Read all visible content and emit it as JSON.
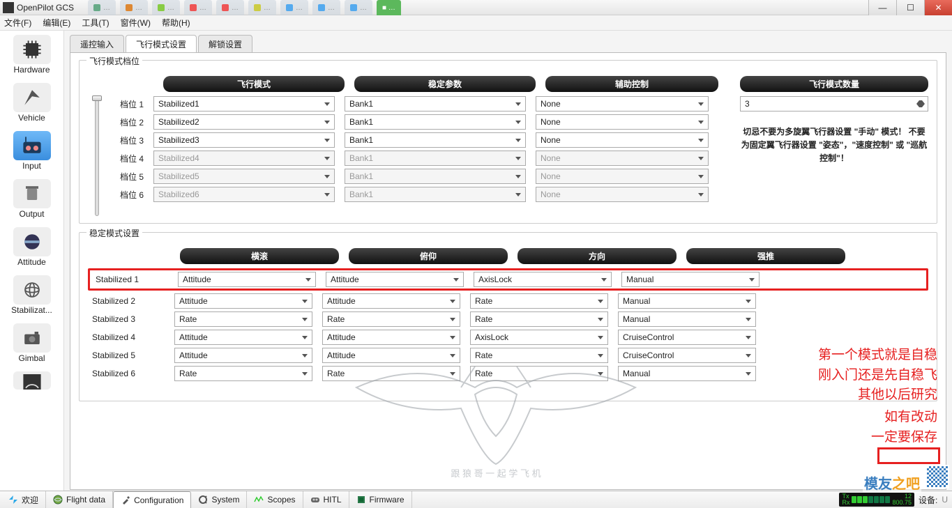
{
  "app": {
    "title": "OpenPilot GCS"
  },
  "window_buttons": {
    "min": "—",
    "max": "☐",
    "close": "✕"
  },
  "menus": [
    "文件(F)",
    "编辑(E)",
    "工具(T)",
    "窗件(W)",
    "帮助(H)"
  ],
  "sidebar": [
    {
      "key": "hardware",
      "label": "Hardware"
    },
    {
      "key": "vehicle",
      "label": "Vehicle"
    },
    {
      "key": "input",
      "label": "Input",
      "selected": true
    },
    {
      "key": "output",
      "label": "Output"
    },
    {
      "key": "attitude",
      "label": "Attitude"
    },
    {
      "key": "stabilization",
      "label": "Stabilizat..."
    },
    {
      "key": "gimbal",
      "label": "Gimbal"
    }
  ],
  "subtabs": [
    "遥控输入",
    "飞行模式设置",
    "解锁设置"
  ],
  "active_subtab": 1,
  "group1_title": "飞行模式档位",
  "headers": [
    "飞行模式",
    "稳定参数",
    "辅助控制",
    "飞行模式数量"
  ],
  "positions": [
    {
      "label": "档位 1",
      "mode": "Stabilized1",
      "bank": "Bank1",
      "aux": "None",
      "enabled": true
    },
    {
      "label": "档位 2",
      "mode": "Stabilized2",
      "bank": "Bank1",
      "aux": "None",
      "enabled": true
    },
    {
      "label": "档位 3",
      "mode": "Stabilized3",
      "bank": "Bank1",
      "aux": "None",
      "enabled": true
    },
    {
      "label": "档位 4",
      "mode": "Stabilized4",
      "bank": "Bank1",
      "aux": "None",
      "enabled": false
    },
    {
      "label": "档位 5",
      "mode": "Stabilized5",
      "bank": "Bank1",
      "aux": "None",
      "enabled": false
    },
    {
      "label": "档位 6",
      "mode": "Stabilized6",
      "bank": "Bank1",
      "aux": "None",
      "enabled": false
    }
  ],
  "mode_count": "3",
  "warning": "切忌不要为多旋翼飞行器设置 \"手动\" 模式！ 不要为固定翼飞行器设置 \"姿态\"，\"速度控制\" 或 \"巡航控制\"！",
  "group2_title": "稳定模式设置",
  "headers2": [
    "横滚",
    "俯仰",
    "方向",
    "强推"
  ],
  "stab_rows": [
    {
      "label": "Stabilized 1",
      "roll": "Attitude",
      "pitch": "Attitude",
      "yaw": "AxisLock",
      "thrust": "Manual",
      "red": true
    },
    {
      "label": "Stabilized 2",
      "roll": "Attitude",
      "pitch": "Attitude",
      "yaw": "Rate",
      "thrust": "Manual"
    },
    {
      "label": "Stabilized 3",
      "roll": "Rate",
      "pitch": "Rate",
      "yaw": "Rate",
      "thrust": "Manual"
    },
    {
      "label": "Stabilized 4",
      "roll": "Attitude",
      "pitch": "Attitude",
      "yaw": "AxisLock",
      "thrust": "CruiseControl"
    },
    {
      "label": "Stabilized 5",
      "roll": "Attitude",
      "pitch": "Attitude",
      "yaw": "Rate",
      "thrust": "CruiseControl"
    },
    {
      "label": "Stabilized 6",
      "roll": "Rate",
      "pitch": "Rate",
      "yaw": "Rate",
      "thrust": "Manual"
    }
  ],
  "annot1": "第一个模式就是自稳\n刚入门还是先自稳飞\n其他以后研究",
  "annot2": "如有改动\n一定要保存",
  "bottom_tabs": [
    {
      "label": "欢迎",
      "icon": "#2aa8e8"
    },
    {
      "label": "Flight data",
      "icon": "#2aa840"
    },
    {
      "label": "Configuration",
      "icon": "#555",
      "active": true
    },
    {
      "label": "System",
      "icon": "#555"
    },
    {
      "label": "Scopes",
      "icon": "#3c3"
    },
    {
      "label": "HITL",
      "icon": "#555"
    },
    {
      "label": "Firmware",
      "icon": "#3a8"
    }
  ],
  "status": {
    "tx": "Tx",
    "rx": "Rx",
    "n1": "12",
    "n2": "800.75",
    "device": "设备:",
    "gcs": "U",
    "watermark": "模友",
    "watermark2": "之吧"
  }
}
